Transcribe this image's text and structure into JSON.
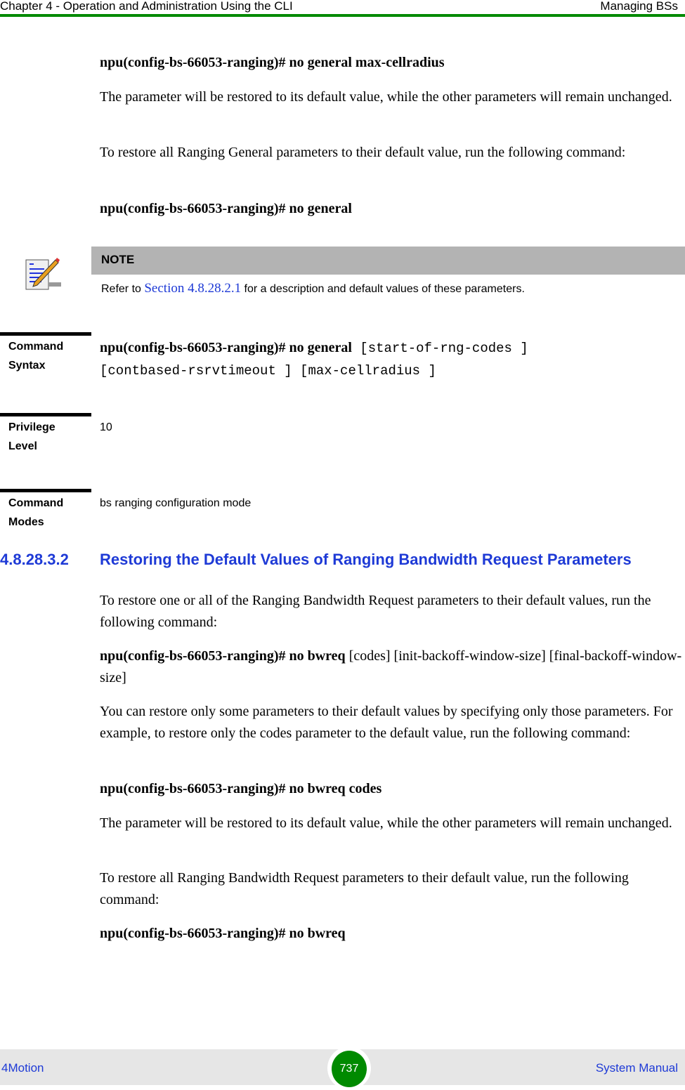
{
  "header": {
    "chapter": "Chapter 4 - Operation and Administration Using the CLI",
    "section": "Managing BSs"
  },
  "top": {
    "cmd1": "npu(config-bs-66053-ranging)# no general max-cellradius",
    "para1": "The parameter will be restored to its default value, while the other parameters will remain unchanged.",
    "para2": "To restore all Ranging General parameters to their default value, run the following command:",
    "cmd2": "npu(config-bs-66053-ranging)# no general"
  },
  "note": {
    "icon": "note-pencil-icon",
    "title": "NOTE",
    "text_before": "Refer to ",
    "link": "Section 4.8.28.2.1",
    "text_after": " for a description and default values of these parameters."
  },
  "command_syntax": {
    "label_line1": "Command",
    "label_line2": "Syntax",
    "bold": "npu(config-bs-66053-ranging)# no general",
    "args_line1": " [start-of-rng-codes ]",
    "args_line2": "[contbased-rsrvtimeout ] [max-cellradius ]"
  },
  "privilege_level": {
    "label_line1": "Privilege",
    "label_line2": "Level",
    "value": "10"
  },
  "command_modes": {
    "label_line1": "Command",
    "label_line2": "Modes",
    "value": "bs ranging configuration mode"
  },
  "section": {
    "number": "4.8.28.3.2",
    "title": "Restoring the Default Values of Ranging Bandwidth Request Parameters",
    "para1": "To restore one or all of the Ranging Bandwidth Request parameters to their default values, run the following command:",
    "cmd1_bold": "npu(config-bs-66053-ranging)# no bwreq",
    "cmd1_args": " [codes] [init-backoff-window-size] [final-backoff-window-size]",
    "para2": "You can restore only some parameters to their default values by specifying only those parameters. For example, to restore only the codes parameter to the default value, run the following command:",
    "cmd2": "npu(config-bs-66053-ranging)# no bwreq codes",
    "para3": "The parameter will be restored to its default value, while the other parameters will remain unchanged.",
    "para4": "To restore all Ranging Bandwidth Request parameters to their default value, run the following command:",
    "cmd3": "npu(config-bs-66053-ranging)# no bwreq"
  },
  "footer": {
    "product": "4Motion",
    "page": "737",
    "doc": "System Manual"
  }
}
